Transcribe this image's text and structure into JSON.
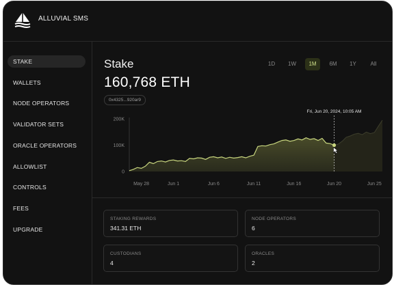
{
  "app": {
    "title": "ALLUVIAL SMS"
  },
  "sidebar": {
    "items": [
      {
        "label": "STAKE",
        "active": true
      },
      {
        "label": "WALLETS"
      },
      {
        "label": "NODE OPERATORS"
      },
      {
        "label": "VALIDATOR SETS"
      },
      {
        "label": "ORACLE OPERATORS"
      },
      {
        "label": "ALLOWLIST"
      },
      {
        "label": "CONTROLS"
      },
      {
        "label": "FEES"
      },
      {
        "label": "UPGRADE"
      }
    ]
  },
  "main": {
    "title": "Stake",
    "total_value": "160,768 ETH",
    "address": "0x4325...920ar9",
    "ranges": [
      "1D",
      "1W",
      "1M",
      "6M",
      "1Y",
      "All"
    ],
    "active_range": "1M",
    "tooltip": "Fri, Jun 20, 2024, 10:05 AM"
  },
  "stats": [
    {
      "label": "STAKING REWARDS",
      "value": "341.31 ETH"
    },
    {
      "label": "NODE OPERATORS",
      "value": "6"
    },
    {
      "label": "CUSTODIANS",
      "value": "4"
    },
    {
      "label": "ORACLES",
      "value": "2"
    }
  ],
  "colors": {
    "accent": "#d8e69a",
    "line": "#c9d77f",
    "background": "#121212"
  },
  "chart_data": {
    "type": "area",
    "title": "",
    "xlabel": "",
    "ylabel": "",
    "y_tick_labels": [
      "0",
      "100K",
      "200K"
    ],
    "x_tick_labels": [
      "May 28",
      "Jun 1",
      "Jun 6",
      "Jun 11",
      "Jun 16",
      "Jun 20",
      "Jun 25"
    ],
    "x_tick_positions": [
      1.5,
      5.5,
      10.5,
      15.5,
      20.5,
      25.5,
      30.5
    ],
    "ylim": [
      0,
      200000
    ],
    "xlim": [
      0,
      31.5
    ],
    "highlight_x": 25.5,
    "series": [
      {
        "x": [
          0,
          0.5,
          1,
          1.5,
          2,
          2.5,
          3,
          3.5,
          4,
          4.5,
          5,
          5.5,
          6,
          6.5,
          7,
          7.5,
          8,
          8.5,
          9,
          9.5,
          10,
          10.5,
          11,
          11.5,
          12,
          12.5,
          13,
          13.5,
          14,
          14.5,
          15,
          15.5,
          16,
          16.5,
          17,
          17.5,
          18,
          18.5,
          19,
          19.5,
          20,
          20.5,
          21,
          21.5,
          22,
          22.5,
          23,
          23.5,
          24,
          24.5,
          25,
          25.5,
          26,
          26.5,
          27,
          27.5,
          28,
          28.5,
          29,
          29.5,
          30,
          30.5,
          31,
          31.5
        ],
        "values": [
          3000,
          8000,
          15000,
          12000,
          20000,
          35000,
          30000,
          38000,
          40000,
          36000,
          42000,
          44000,
          40000,
          41000,
          38000,
          50000,
          48000,
          52000,
          51000,
          46000,
          54000,
          56000,
          52000,
          55000,
          50000,
          54000,
          51000,
          53000,
          56000,
          52000,
          58000,
          62000,
          95000,
          98000,
          97000,
          102000,
          105000,
          112000,
          118000,
          120000,
          115000,
          118000,
          124000,
          120000,
          128000,
          122000,
          125000,
          118000,
          126000,
          108000,
          106000,
          100000,
          104000,
          115000,
          130000,
          135000,
          142000,
          145000,
          140000,
          150000,
          144000,
          148000,
          172000,
          195000
        ]
      }
    ]
  }
}
